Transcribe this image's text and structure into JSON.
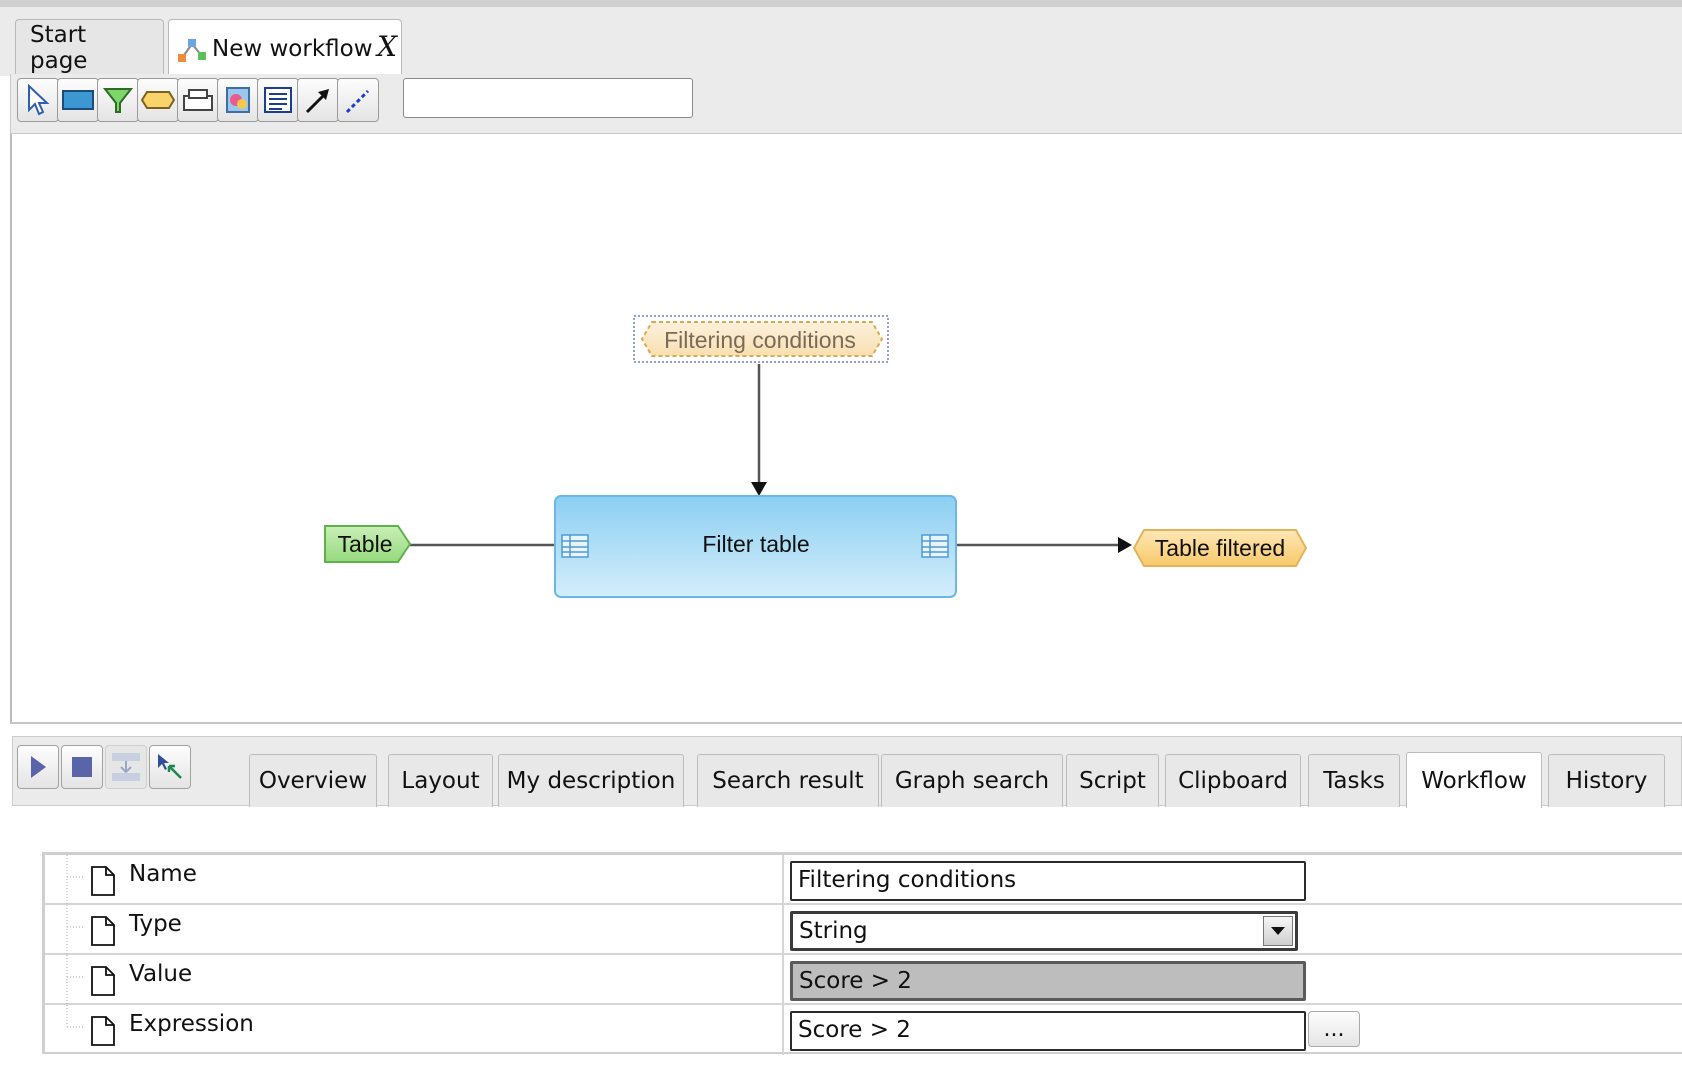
{
  "tabs": {
    "start_label": "Start page",
    "workflow_label": "New workflow",
    "close_glyph": "X"
  },
  "toolbar": {
    "tools": [
      {
        "name": "pointer-select-icon"
      },
      {
        "name": "rectangle-node-icon"
      },
      {
        "name": "filter-funnel-icon"
      },
      {
        "name": "hexagon-parameter-icon"
      },
      {
        "name": "stack-node-icon"
      },
      {
        "name": "database-node-icon"
      },
      {
        "name": "document-note-icon"
      },
      {
        "name": "connector-arrow-icon"
      },
      {
        "name": "dashed-connector-icon"
      }
    ],
    "search_value": ""
  },
  "diagram": {
    "parameter_node": "Filtering conditions",
    "input_node": "Table",
    "process_node": "Filter table",
    "output_node": "Table filtered",
    "colors": {
      "input_fill": "#aee39a",
      "process_fill": "#a9dcf6",
      "output_fill": "#fcd98d",
      "param_fill": "#fbe7c3"
    }
  },
  "lower_panel": {
    "run_buttons": [
      {
        "name": "play-icon"
      },
      {
        "name": "stop-icon"
      },
      {
        "name": "step-into-icon"
      },
      {
        "name": "select-cursor-icon"
      }
    ],
    "tabs": [
      "Overview",
      "Layout",
      "My description",
      "Search result",
      "Graph search",
      "Script",
      "Clipboard",
      "Tasks",
      "Workflow",
      "History"
    ],
    "active_tab": "Workflow"
  },
  "properties": {
    "rows": [
      {
        "label": "Name",
        "value": "Filtering conditions"
      },
      {
        "label": "Type",
        "value": "String"
      },
      {
        "label": "Value",
        "value": "Score > 2"
      },
      {
        "label": "Expression",
        "value": "Score > 2"
      }
    ],
    "expression_button": "..."
  }
}
